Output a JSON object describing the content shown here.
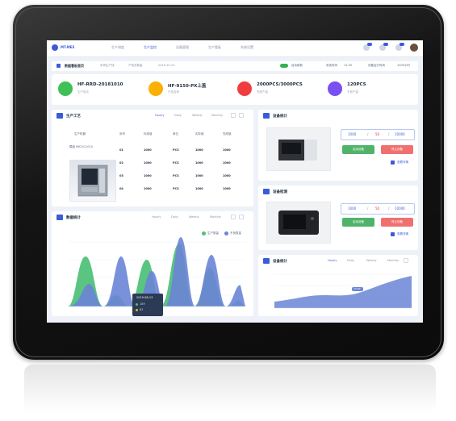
{
  "topbar": {
    "brand": "MT-MES",
    "nav": [
      "生产调度",
      "生产监控",
      "设备管理",
      "生产看板",
      "系统设置"
    ],
    "badges": [
      "8",
      "2",
      "5"
    ]
  },
  "subbar": {
    "title": "数据看板首页",
    "info": [
      "车间生产线",
      "产线总数量",
      "2019-10-10"
    ],
    "toggle_label": "自动刷新",
    "right": [
      "系统时间",
      "12:30",
      "设备运行时间",
      "1000小时"
    ]
  },
  "stats": [
    {
      "value": "HF-RRD-20181010",
      "label": "生产批次",
      "color": "#40c057"
    },
    {
      "value": "HF-9150-PX上盖",
      "label": "产品名称",
      "color": "#fab005"
    },
    {
      "value": "2000PCS/3000PCS",
      "label": "完成产量",
      "color": "#f03e3e"
    },
    {
      "value": "120PCS",
      "label": "不良产量",
      "color": "#7950f2"
    }
  ],
  "process": {
    "title": "生产工艺",
    "tabs": [
      "Hourly",
      "Daily",
      "Weekly",
      "Monthly"
    ],
    "headers": [
      "生产机器",
      "序号",
      "标准值",
      "单位",
      "实际值",
      "完成值"
    ],
    "machine_label": "模组 MK2011010",
    "rows": [
      [
        "01",
        "1000",
        "PCS",
        "1000",
        "1000"
      ],
      [
        "02",
        "1000",
        "PCS",
        "1000",
        "1000"
      ],
      [
        "03",
        "1000",
        "PCS",
        "1000",
        "1000"
      ],
      [
        "04",
        "1000",
        "PCS",
        "1000",
        "1000"
      ]
    ]
  },
  "stats_chart": {
    "title": "数据统计",
    "tabs": [
      "Hourly",
      "Daily",
      "Weekly",
      "Monthly"
    ],
    "legend": [
      "生产数量",
      "不良数量"
    ],
    "tooltip": {
      "title": "2019-08-13",
      "rows": [
        "189",
        "62"
      ]
    },
    "colors": {
      "green": "#51c17a",
      "blue": "#6a85d6"
    }
  },
  "device1": {
    "title": "设备统计",
    "values": [
      "1000",
      "50",
      "10000"
    ],
    "start_label": "启动设备",
    "stop_label": "停止设备",
    "link": "查看详情"
  },
  "device2": {
    "title": "设备检测",
    "values": [
      "1000",
      "50",
      "10000"
    ],
    "start_label": "启动设备",
    "stop_label": "停止设备",
    "link": "查看详情"
  },
  "device3": {
    "title": "设备统计",
    "tabs": [
      "Hourly",
      "Daily",
      "Weekly",
      "Monthly"
    ],
    "bubble": "12,00"
  }
}
